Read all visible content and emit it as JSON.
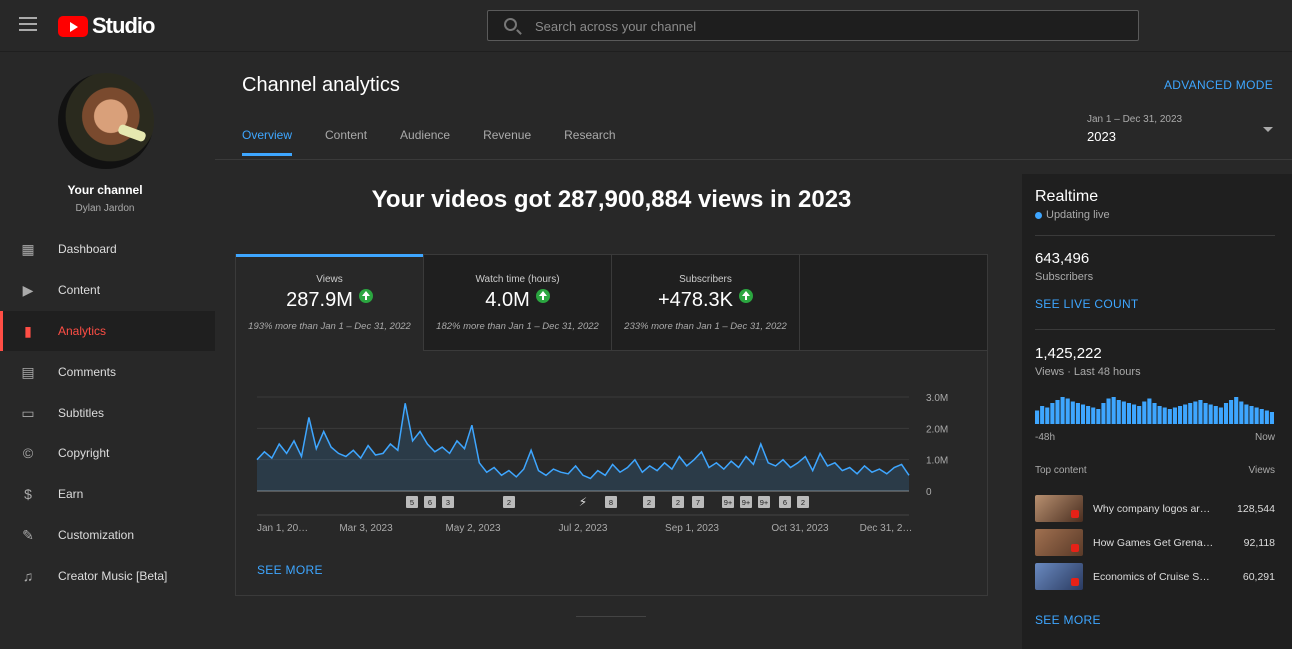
{
  "app": {
    "logo_text": "Studio",
    "search_placeholder": "Search across your channel"
  },
  "sidebar": {
    "channel_label": "Your channel",
    "channel_name": "Dylan Jardon",
    "items": [
      {
        "label": "Dashboard",
        "icon": "dashboard-icon",
        "active": false
      },
      {
        "label": "Content",
        "icon": "content-icon",
        "active": false
      },
      {
        "label": "Analytics",
        "icon": "analytics-icon",
        "active": true
      },
      {
        "label": "Comments",
        "icon": "comments-icon",
        "active": false
      },
      {
        "label": "Subtitles",
        "icon": "subtitles-icon",
        "active": false
      },
      {
        "label": "Copyright",
        "icon": "copyright-icon",
        "active": false
      },
      {
        "label": "Earn",
        "icon": "earn-icon",
        "active": false
      },
      {
        "label": "Customization",
        "icon": "customization-icon",
        "active": false
      },
      {
        "label": "Creator Music [Beta]",
        "icon": "creator-music-icon",
        "active": false
      }
    ]
  },
  "header": {
    "title": "Channel analytics",
    "advanced_mode": "ADVANCED MODE",
    "tabs": [
      "Overview",
      "Content",
      "Audience",
      "Revenue",
      "Research"
    ],
    "active_tab": "Overview",
    "date_range": "Jan 1 – Dec 31, 2023",
    "date_year": "2023"
  },
  "overview": {
    "headline": "Your videos got 287,900,884 views in 2023",
    "metrics": [
      {
        "label": "Views",
        "value": "287.9M",
        "comparison": "193% more than Jan 1 – Dec 31, 2022"
      },
      {
        "label": "Watch time (hours)",
        "value": "4.0M",
        "comparison": "182% more than Jan 1 – Dec 31, 2022"
      },
      {
        "label": "Subscribers",
        "value": "+478.3K",
        "comparison": "233% more than Jan 1 – Dec 31, 2022"
      }
    ],
    "see_more": "SEE MORE"
  },
  "chart_data": {
    "type": "area",
    "title": "",
    "xlabel": "",
    "ylabel": "",
    "ylim": [
      0,
      3000000
    ],
    "y_ticks": [
      "0",
      "1.0M",
      "2.0M",
      "3.0M"
    ],
    "x_tick_labels": [
      "Jan 1, 20…",
      "Mar 3, 2023",
      "May 2, 2023",
      "Jul 2, 2023",
      "Sep 1, 2023",
      "Oct 31, 2023",
      "Dec 31, 2…"
    ],
    "series": [
      {
        "values": [
          1000000,
          1250000,
          1050000,
          1500000,
          1200000,
          1600000,
          1100000,
          2350000,
          1350000,
          1900000,
          1400000,
          1200000,
          1100000,
          1300000,
          1050000,
          1450000,
          1150000,
          1200000,
          1500000,
          1300000,
          2800000,
          1600000,
          1900000,
          1500000,
          1250000,
          1400000,
          1200000,
          1600000,
          1350000,
          2100000,
          900000,
          600000,
          750000,
          500000,
          650000,
          450000,
          700000,
          1300000,
          650000,
          500000,
          700000,
          600000,
          550000,
          800000,
          500000,
          400000,
          650000,
          500000,
          850000,
          600000,
          750000,
          1000000,
          600000,
          800000,
          650000,
          900000,
          700000,
          1100000,
          800000,
          1000000,
          1250000,
          750000,
          900000,
          700000,
          950000,
          750000,
          1100000,
          850000,
          1500000,
          900000,
          800000,
          1000000,
          750000,
          900000,
          1100000,
          650000,
          1200000,
          800000,
          900000,
          650000,
          750000,
          550000,
          800000,
          600000,
          700000,
          550000,
          750000,
          850000,
          500000
        ]
      }
    ],
    "markers": [
      "5",
      "6",
      "3",
      "2",
      "shorts",
      "8",
      "2",
      "2",
      "7",
      "9+",
      "9+",
      "9+",
      "6",
      "2"
    ]
  },
  "realtime": {
    "title": "Realtime",
    "status": "Updating live",
    "subscribers": "643,496",
    "subscribers_label": "Subscribers",
    "see_live_count": "SEE LIVE COUNT",
    "views": "1,425,222",
    "views_label": "Views · Last 48 hours",
    "bars": [
      0.45,
      0.6,
      0.55,
      0.7,
      0.8,
      0.9,
      0.85,
      0.75,
      0.7,
      0.65,
      0.6,
      0.55,
      0.5,
      0.7,
      0.85,
      0.9,
      0.8,
      0.75,
      0.7,
      0.65,
      0.6,
      0.75,
      0.85,
      0.7,
      0.6,
      0.55,
      0.5,
      0.55,
      0.6,
      0.65,
      0.7,
      0.75,
      0.8,
      0.7,
      0.65,
      0.6,
      0.55,
      0.7,
      0.8,
      0.9,
      0.75,
      0.65,
      0.6,
      0.55,
      0.5,
      0.45,
      0.4
    ],
    "axis_left": "-48h",
    "axis_right": "Now",
    "top_content_label": "Top content",
    "top_views_label": "Views",
    "top_content": [
      {
        "title": "Why company logos are…",
        "views": "128,544"
      },
      {
        "title": "How Games Get Grenade…",
        "views": "92,118"
      },
      {
        "title": "Economics of Cruise Shi…",
        "views": "60,291"
      }
    ],
    "see_more": "SEE MORE"
  }
}
